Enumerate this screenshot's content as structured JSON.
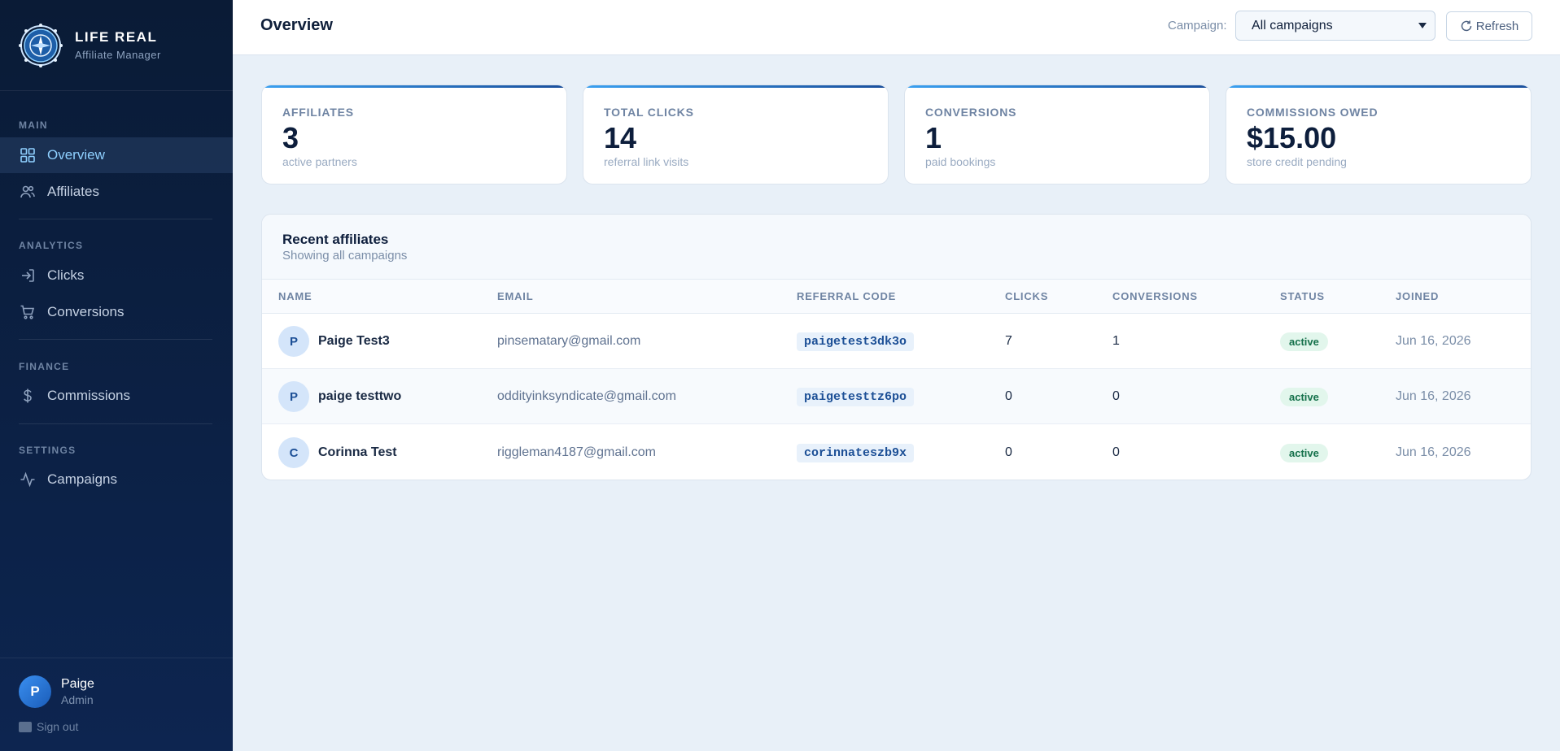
{
  "brand": {
    "name": "LIFE REAL",
    "subtitle": "Affiliate Manager"
  },
  "nav": {
    "sections": {
      "main": "MAIN",
      "analytics": "ANALYTICS",
      "finance": "FINANCE",
      "settings": "SETTINGS"
    },
    "items": {
      "overview": "Overview",
      "affiliates": "Affiliates",
      "clicks": "Clicks",
      "conversions": "Conversions",
      "commissions": "Commissions",
      "campaigns": "Campaigns"
    },
    "active": "overview"
  },
  "user": {
    "initial": "P",
    "name": "Paige",
    "role": "Admin",
    "signout": "Sign out"
  },
  "header": {
    "title": "Overview",
    "campaign_label": "Campaign:",
    "campaign_selected": "All campaigns",
    "refresh_label": "Refresh"
  },
  "stats": [
    {
      "label": "AFFILIATES",
      "value": "3",
      "sub": "active partners"
    },
    {
      "label": "TOTAL CLICKS",
      "value": "14",
      "sub": "referral link visits"
    },
    {
      "label": "CONVERSIONS",
      "value": "1",
      "sub": "paid bookings"
    },
    {
      "label": "COMMISSIONS OWED",
      "value": "$15.00",
      "sub": "store credit pending"
    }
  ],
  "recent": {
    "title": "Recent affiliates",
    "subtitle": "Showing all campaigns",
    "columns": [
      "NAME",
      "EMAIL",
      "REFERRAL CODE",
      "CLICKS",
      "CONVERSIONS",
      "STATUS",
      "JOINED"
    ],
    "rows": [
      {
        "initial": "P",
        "name": "Paige Test3",
        "email": "pinsematary@gmail.com",
        "code": "paigetest3dk3o",
        "clicks": "7",
        "conversions": "1",
        "status": "active",
        "joined": "Jun 16, 2026"
      },
      {
        "initial": "P",
        "name": "paige testtwo",
        "email": "oddityinksyndicate@gmail.com",
        "code": "paigetesttz6po",
        "clicks": "0",
        "conversions": "0",
        "status": "active",
        "joined": "Jun 16, 2026"
      },
      {
        "initial": "C",
        "name": "Corinna Test",
        "email": "riggleman4187@gmail.com",
        "code": "corinnateszb9x",
        "clicks": "0",
        "conversions": "0",
        "status": "active",
        "joined": "Jun 16, 2026"
      }
    ]
  },
  "colors": {
    "accent": "#3aa0f0",
    "sidebar": "#0a1b36",
    "active_nav": "#8fd0ff",
    "status_active": "#14704a"
  }
}
